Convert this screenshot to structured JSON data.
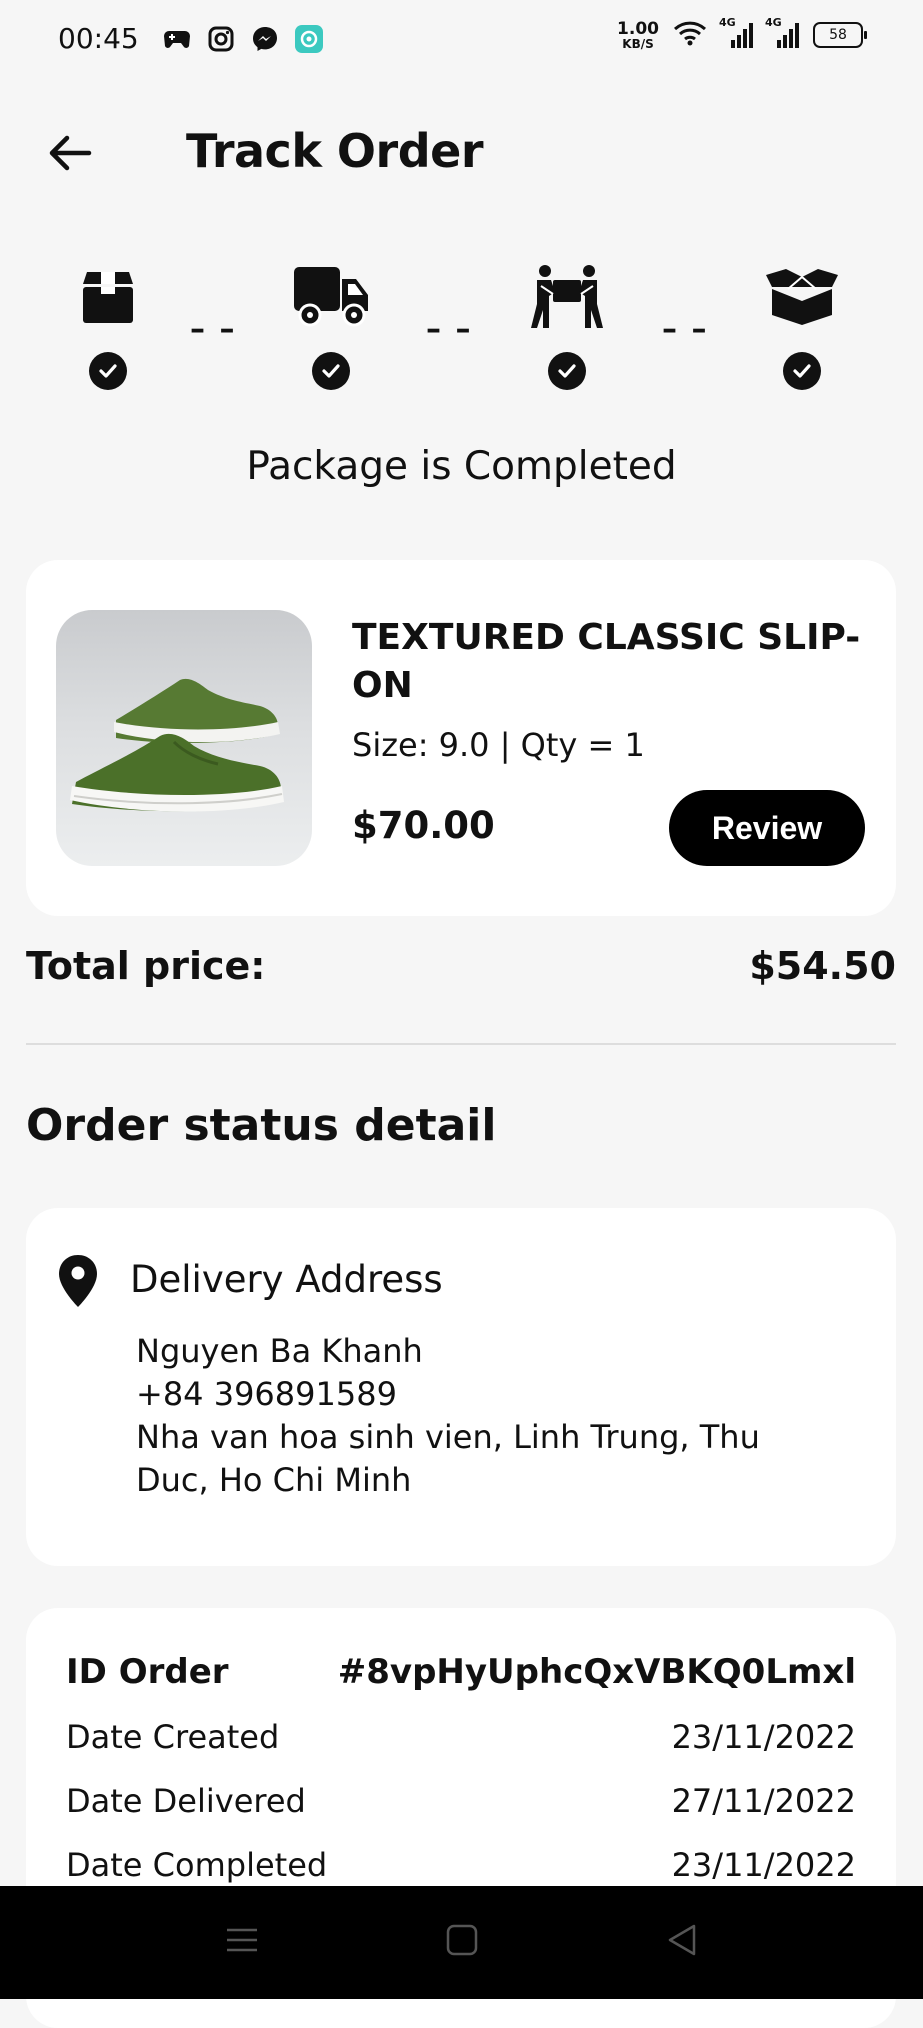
{
  "status_bar": {
    "time": "00:45",
    "left_icons": [
      "game-controller-icon",
      "instagram-icon",
      "messenger-icon",
      "app-icon"
    ],
    "net_speed_value": "1.00",
    "net_speed_unit": "KB/S",
    "signal1_label": "4G",
    "signal2_label": "4G",
    "battery": "58"
  },
  "header": {
    "title": "Track Order",
    "back_icon": "arrow-left-icon"
  },
  "stepper": {
    "steps": [
      {
        "icon": "package-icon",
        "done": true
      },
      {
        "icon": "truck-icon",
        "done": true
      },
      {
        "icon": "delivery-people-icon",
        "done": true
      },
      {
        "icon": "open-box-icon",
        "done": true
      }
    ],
    "separator": "– –",
    "status_text": "Package is Completed"
  },
  "product": {
    "name": "TEXTURED CLASSIC SLIP-ON",
    "size_qty": "Size: 9.0 | Qty = 1",
    "price": "$70.00",
    "review_label": "Review"
  },
  "total": {
    "label": "Total price:",
    "value": "$54.50"
  },
  "order_status": {
    "title": "Order status detail",
    "address": {
      "title": "Delivery Address",
      "name": "Nguyen Ba Khanh",
      "phone": "+84 396891589",
      "line1": "Nha van hoa sinh vien, Linh Trung, Thu",
      "line2": "Duc, Ho Chi Minh"
    },
    "info": {
      "id_label": "ID Order",
      "id_value": "#8vpHyUphcQxVBKQ0Lmxl",
      "created_label": "Date Created",
      "created_value": "23/11/2022",
      "delivered_label": "Date Delivered",
      "delivered_value": "27/11/2022",
      "completed_label": "Date Completed",
      "completed_value": "23/11/2022"
    }
  },
  "nav_bar": {
    "icons": [
      "menu-icon",
      "home-square-icon",
      "back-triangle-icon"
    ]
  }
}
